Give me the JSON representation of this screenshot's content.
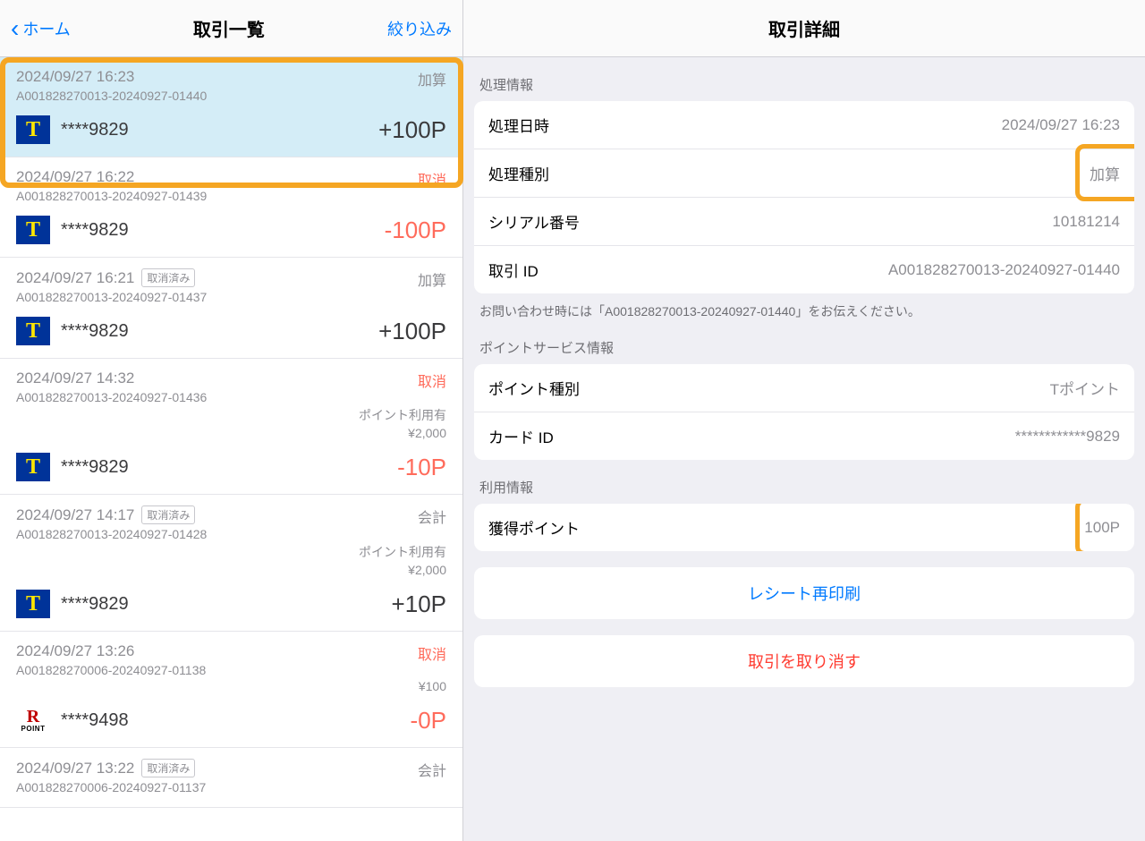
{
  "nav": {
    "back_label": "ホーム",
    "list_title": "取引一覧",
    "filter_label": "絞り込み",
    "detail_title": "取引詳細"
  },
  "transactions": [
    {
      "datetime": "2024/09/27 16:23",
      "type_label": "加算",
      "type_class": "",
      "id": "A001828270013-20240927-01440",
      "tag": "",
      "extra1": "",
      "extra2": "",
      "icon": "tpoint",
      "card_masked": "****9829",
      "points": "+100P",
      "points_class": "",
      "selected": true
    },
    {
      "datetime": "2024/09/27 16:22",
      "type_label": "取消",
      "type_class": "cancel",
      "id": "A001828270013-20240927-01439",
      "tag": "",
      "extra1": "",
      "extra2": "",
      "icon": "tpoint",
      "card_masked": "****9829",
      "points": "-100P",
      "points_class": "neg",
      "selected": false
    },
    {
      "datetime": "2024/09/27 16:21",
      "type_label": "加算",
      "type_class": "",
      "id": "A001828270013-20240927-01437",
      "tag": "取消済み",
      "extra1": "",
      "extra2": "",
      "icon": "tpoint",
      "card_masked": "****9829",
      "points": "+100P",
      "points_class": "",
      "selected": false
    },
    {
      "datetime": "2024/09/27 14:32",
      "type_label": "取消",
      "type_class": "cancel",
      "id": "A001828270013-20240927-01436",
      "tag": "",
      "extra1": "ポイント利用有",
      "extra2": "¥2,000",
      "icon": "tpoint",
      "card_masked": "****9829",
      "points": "-10P",
      "points_class": "neg",
      "selected": false
    },
    {
      "datetime": "2024/09/27 14:17",
      "type_label": "会計",
      "type_class": "",
      "id": "A001828270013-20240927-01428",
      "tag": "取消済み",
      "extra1": "ポイント利用有",
      "extra2": "¥2,000",
      "icon": "tpoint",
      "card_masked": "****9829",
      "points": "+10P",
      "points_class": "",
      "selected": false
    },
    {
      "datetime": "2024/09/27 13:26",
      "type_label": "取消",
      "type_class": "cancel",
      "id": "A001828270006-20240927-01138",
      "tag": "",
      "extra1": "",
      "extra2": "¥100",
      "icon": "rpoint",
      "card_masked": "****9498",
      "points": "-0P",
      "points_class": "neg",
      "selected": false
    },
    {
      "datetime": "2024/09/27 13:22",
      "type_label": "会計",
      "type_class": "",
      "id": "A001828270006-20240927-01137",
      "tag": "取消済み",
      "extra1": "",
      "extra2": "",
      "icon": "rpoint",
      "card_masked": "",
      "points": "",
      "points_class": "",
      "selected": false
    }
  ],
  "detail": {
    "sections": {
      "processing_header": "処理情報",
      "processing_rows": [
        {
          "label": "処理日時",
          "value": "2024/09/27 16:23",
          "highlight": false
        },
        {
          "label": "処理種別",
          "value": "加算",
          "highlight": true
        },
        {
          "label": "シリアル番号",
          "value": "10181214",
          "highlight": false
        },
        {
          "label": "取引 ID",
          "value": "A001828270013-20240927-01440",
          "highlight": false
        }
      ],
      "processing_note": "お問い合わせ時には「A001828270013-20240927-01440」をお伝えください。",
      "pointservice_header": "ポイントサービス情報",
      "pointservice_rows": [
        {
          "label": "ポイント種別",
          "value": "Tポイント",
          "highlight": false
        },
        {
          "label": "カード ID",
          "value": "************9829",
          "highlight": false
        }
      ],
      "usage_header": "利用情報",
      "usage_rows": [
        {
          "label": "獲得ポイント",
          "value": "100P",
          "highlight": true
        }
      ]
    },
    "actions": {
      "reprint": "レシート再印刷",
      "cancel_tx": "取引を取り消す"
    }
  }
}
